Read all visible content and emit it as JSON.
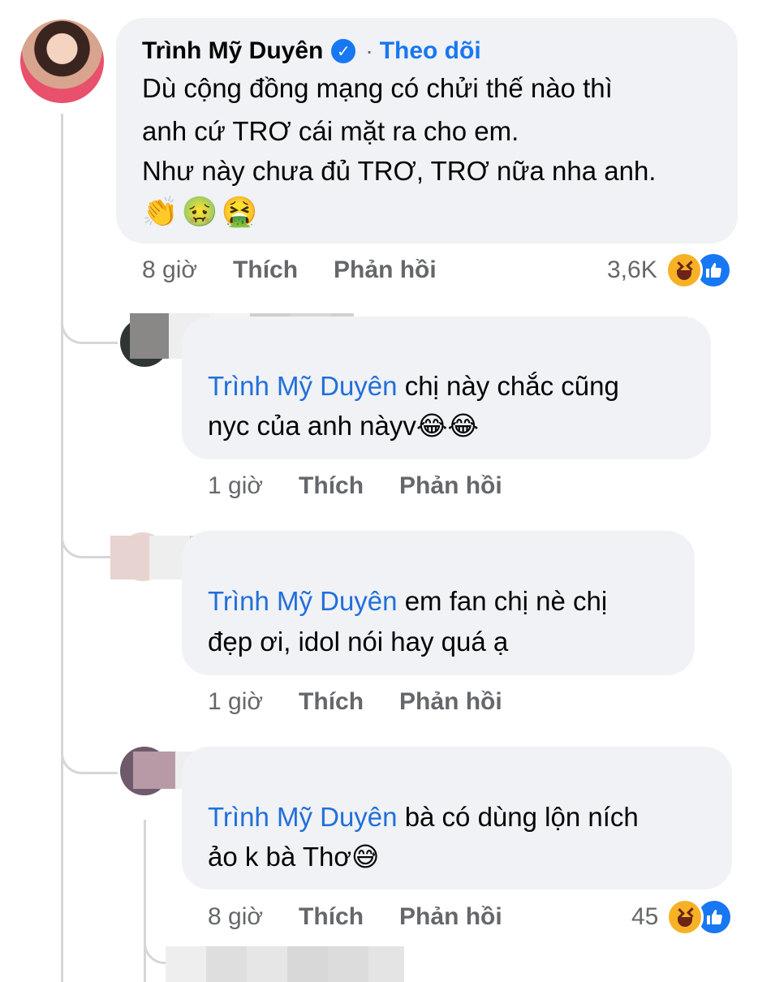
{
  "main_comment": {
    "author": "Trình Mỹ Duyên",
    "follow_label": "Theo dõi",
    "lines": [
      "Dù cộng đồng mạng có chửi thế nào thì",
      "anh cứ TRƠ cái mặt ra cho em.",
      "Như này chưa đủ TRƠ, TRƠ nữa nha anh."
    ],
    "emojis": "👏🤢🤮",
    "time": "8 giờ",
    "like_label": "Thích",
    "reply_label": "Phản hồi",
    "reaction_count": "3,6K"
  },
  "replies": [
    {
      "mention": "Trình Mỹ Duyên",
      "line1": "chị này chắc cũng",
      "line2": "nyc của anh nàyv😂😂",
      "time": "1 giờ",
      "like_label": "Thích",
      "reply_label": "Phản hồi"
    },
    {
      "mention": "Trình Mỹ Duyên",
      "line1": "em fan chị nè chị",
      "line2": "đẹp ơi, idol nói hay quá ạ",
      "time": "1 giờ",
      "like_label": "Thích",
      "reply_label": "Phản hồi"
    },
    {
      "mention": "Trình Mỹ Duyên",
      "line1": "bà có dùng lộn ních",
      "line2": "ảo k bà Thơ😅",
      "time": "8 giờ",
      "like_label": "Thích",
      "reply_label": "Phản hồi",
      "reaction_count": "45"
    }
  ],
  "icons": {
    "verified": "verified-badge-icon",
    "reaction_haha": "haha-reaction-icon",
    "reaction_like": "like-reaction-icon"
  },
  "colors": {
    "mention": "#216fdb",
    "follow": "#1877f2",
    "bubble": "#f0f2f5",
    "meta": "#65676b"
  }
}
